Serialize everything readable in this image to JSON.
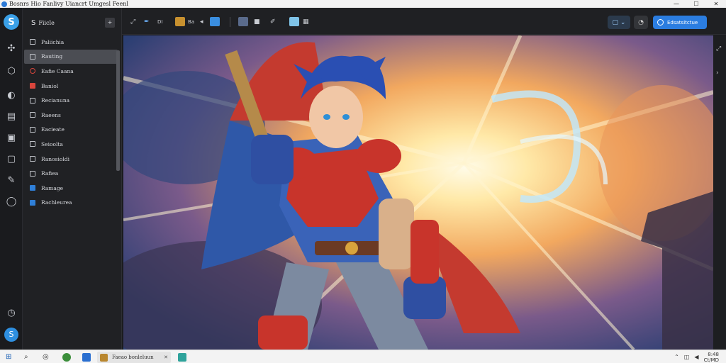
{
  "window": {
    "title": "Bosnrs Hio Fanlivy Uiancrt Umgesl Feenl",
    "controls": [
      "minimize",
      "maximize",
      "close"
    ]
  },
  "rail": {
    "logo_label": "S",
    "icons": [
      "logo-icon",
      "puzzle-icon",
      "hexagon-icon",
      "mask-icon",
      "layers-icon",
      "window-icon",
      "frame-icon",
      "brush-icon",
      "circle-icon",
      "clock-icon",
      "account-icon"
    ],
    "account_label": "S"
  },
  "panel": {
    "title": "Fiicle",
    "title_icon": "S",
    "header_button": "+",
    "items": [
      {
        "label": "Paliichia",
        "icon": "square-outline",
        "selected": false
      },
      {
        "label": "Rauting",
        "icon": "square-outline",
        "selected": true
      },
      {
        "label": "Eafie Caana",
        "icon": "circle-red",
        "selected": false
      },
      {
        "label": "Baniol",
        "icon": "square-red",
        "selected": false
      },
      {
        "label": "Recianuna",
        "icon": "square-outline",
        "selected": false
      },
      {
        "label": "Raeens",
        "icon": "square-outline",
        "selected": false
      },
      {
        "label": "Eacieate",
        "icon": "square-outline",
        "selected": false
      },
      {
        "label": "Seioolta",
        "icon": "square-outline",
        "selected": false
      },
      {
        "label": "Ranosioldi",
        "icon": "square-outline",
        "selected": false
      },
      {
        "label": "Rafiea",
        "icon": "square-outline",
        "selected": false
      },
      {
        "label": "Ramage",
        "icon": "square-blue",
        "selected": false
      },
      {
        "label": "Rachleurea",
        "icon": "square-blue",
        "selected": false
      }
    ]
  },
  "toolbar": {
    "tool_a": "DI",
    "tool_b": "Ba",
    "primary_button": "Edsatsitctue",
    "right_pill_label": "⌄"
  },
  "canvas": {
    "subject": "armored blue-haired warrior with red cape and glowing energy burst",
    "colors": {
      "sky": "#2c3f73",
      "burst": "#fff6d6",
      "armor": "#c8342b",
      "cape": "#2f58a8",
      "hair": "#2a4fb3"
    }
  },
  "taskbar": {
    "task_label": "Faeao bonleluun",
    "tray_time": "8:48",
    "tray_date": "Ct/MD"
  }
}
